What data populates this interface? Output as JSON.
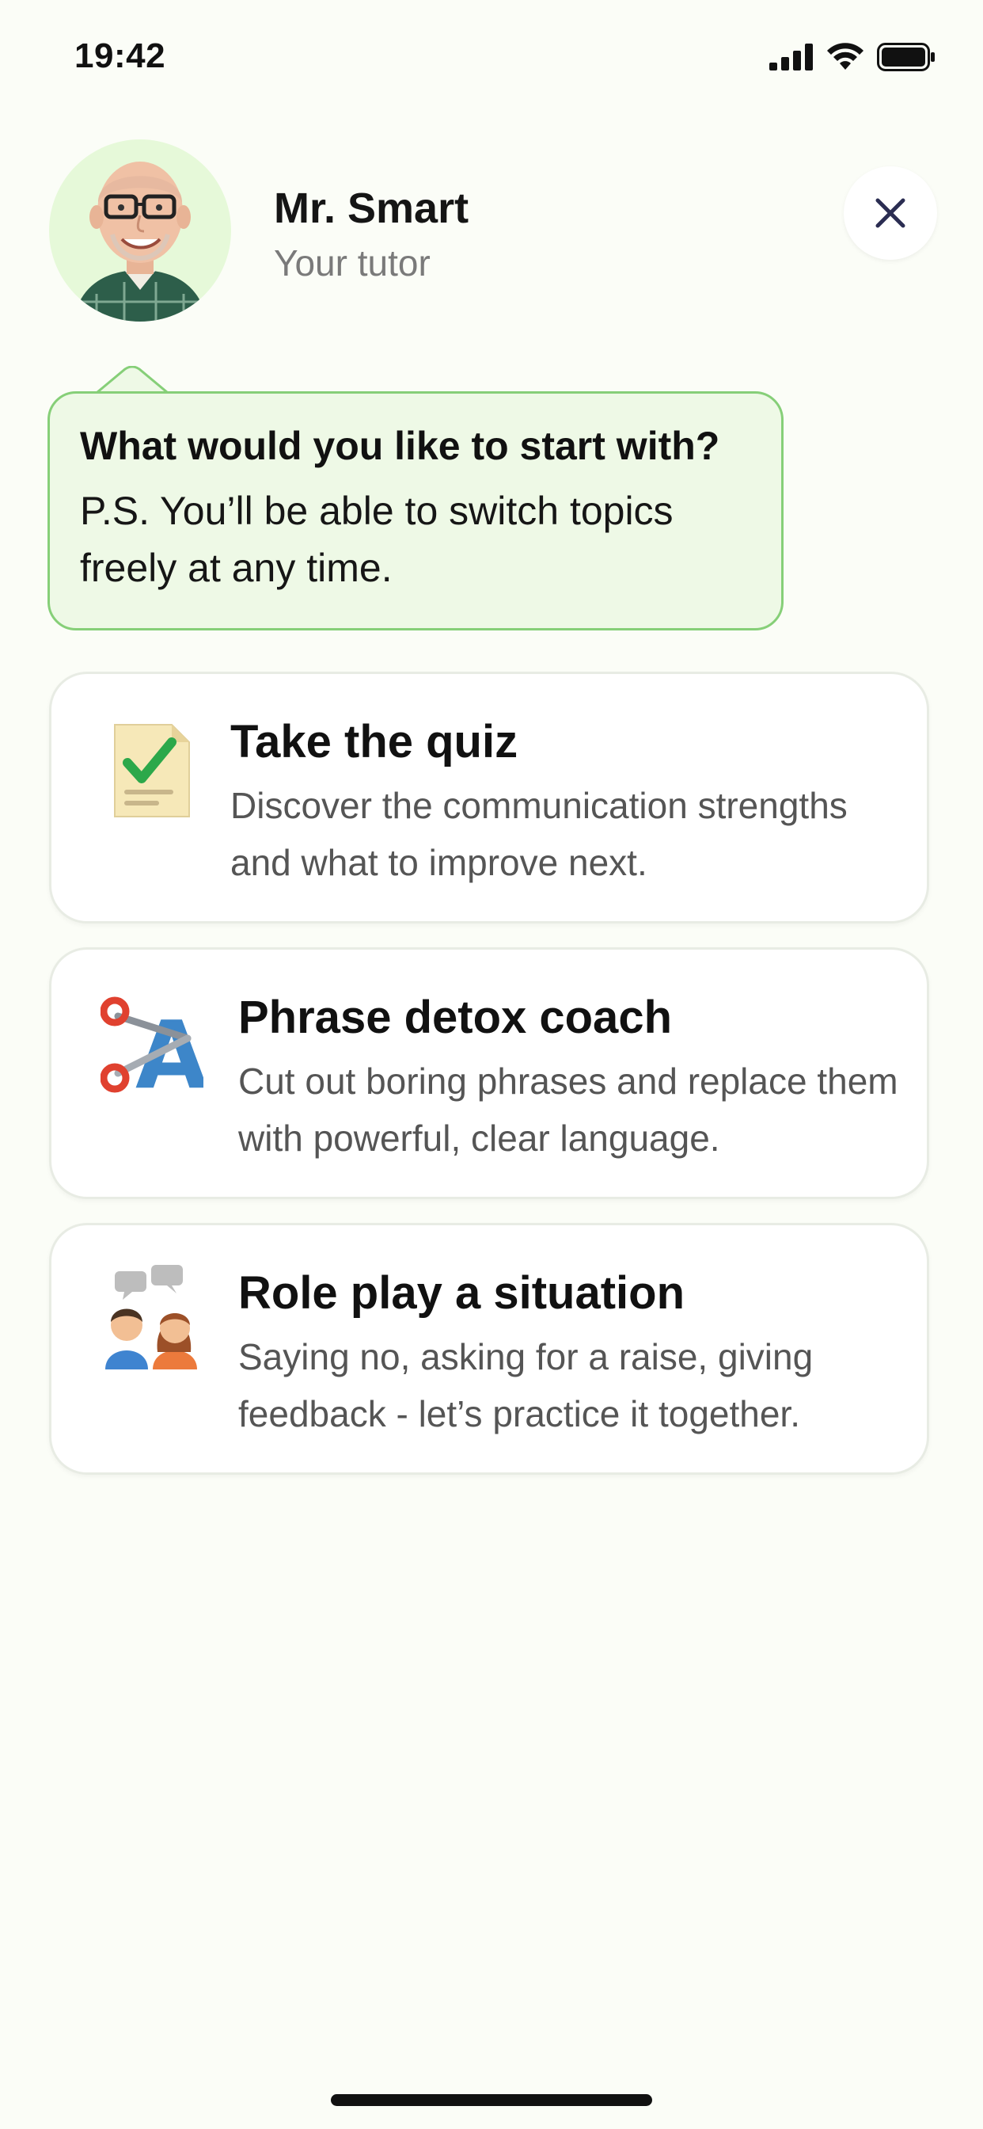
{
  "status_bar": {
    "time": "19:42"
  },
  "tutor": {
    "name": "Mr. Smart",
    "role": "Your tutor"
  },
  "bubble": {
    "title": "What would you like to start with?",
    "text": "P.S. You’ll be able to switch topics freely at any time."
  },
  "options": [
    {
      "title": "Take the quiz",
      "description": "Discover the communication strengths and what to improve next.",
      "icon": "quiz-document-icon"
    },
    {
      "title": "Phrase detox coach",
      "description": "Cut out boring phrases and replace them with powerful, clear language.",
      "icon": "scissors-letter-icon"
    },
    {
      "title": "Role play a situation",
      "description": "Saying no, asking for a raise, giving feedback - let’s practice it together.",
      "icon": "people-talking-icon"
    }
  ],
  "colors": {
    "background": "#fbfdf7",
    "bubble_fill": "#eef9e6",
    "bubble_border": "#86cf78",
    "close_icon": "#2b2d52"
  }
}
